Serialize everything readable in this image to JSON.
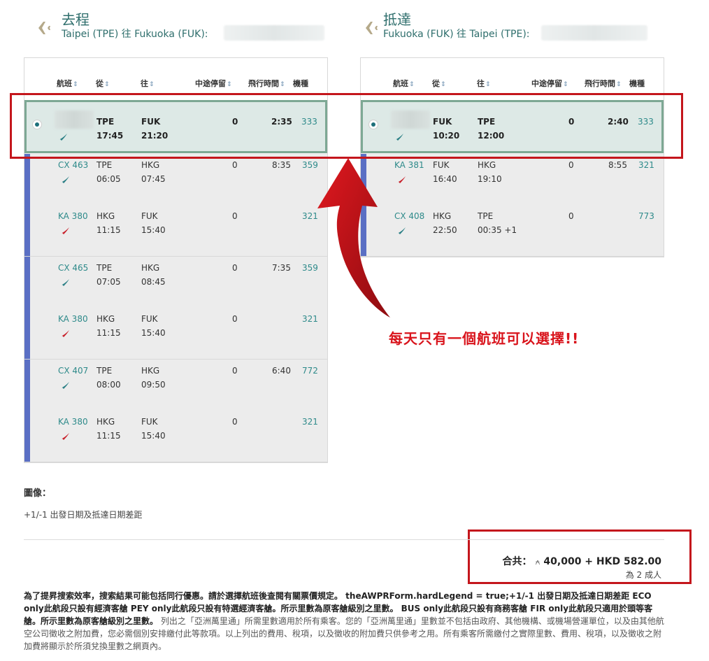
{
  "outbound": {
    "title": "去程",
    "route": "Taipei (TPE) 往 Fukuoka (FUK):"
  },
  "inbound": {
    "title": "抵達",
    "route": "Fukuoka (FUK) 往 Taipei (TPE):"
  },
  "columns": {
    "flight": "航班",
    "from": "從",
    "to": "往",
    "stops": "中途停留",
    "duration": "飛行時間",
    "aircraft": "機種",
    "sort_icon": "⇕"
  },
  "outbound_selected": {
    "from": "TPE",
    "dep": "17:45",
    "to": "FUK",
    "arr": "21:20",
    "stops": "0",
    "duration": "2:35",
    "aircraft": "333"
  },
  "outbound_options": [
    {
      "duration": "8:35",
      "legs": [
        {
          "flight": "CX 463",
          "from": "TPE",
          "dep": "06:05",
          "to": "HKG",
          "arr": "07:45",
          "stops": "0",
          "aircraft": "359",
          "airline": "cathay"
        },
        {
          "flight": "KA 380",
          "from": "HKG",
          "dep": "11:15",
          "to": "FUK",
          "arr": "15:40",
          "stops": "0",
          "aircraft": "321",
          "airline": "dragon"
        }
      ]
    },
    {
      "duration": "7:35",
      "legs": [
        {
          "flight": "CX 465",
          "from": "TPE",
          "dep": "07:05",
          "to": "HKG",
          "arr": "08:45",
          "stops": "0",
          "aircraft": "359",
          "airline": "cathay"
        },
        {
          "flight": "KA 380",
          "from": "HKG",
          "dep": "11:15",
          "to": "FUK",
          "arr": "15:40",
          "stops": "0",
          "aircraft": "321",
          "airline": "dragon"
        }
      ]
    },
    {
      "duration": "6:40",
      "legs": [
        {
          "flight": "CX 407",
          "from": "TPE",
          "dep": "08:00",
          "to": "HKG",
          "arr": "09:50",
          "stops": "0",
          "aircraft": "772",
          "airline": "cathay"
        },
        {
          "flight": "KA 380",
          "from": "HKG",
          "dep": "11:15",
          "to": "FUK",
          "arr": "15:40",
          "stops": "0",
          "aircraft": "321",
          "airline": "dragon"
        }
      ]
    }
  ],
  "inbound_selected": {
    "from": "FUK",
    "dep": "10:20",
    "to": "TPE",
    "arr": "12:00",
    "stops": "0",
    "duration": "2:40",
    "aircraft": "333"
  },
  "inbound_options": [
    {
      "duration": "8:55",
      "legs": [
        {
          "flight": "KA 381",
          "from": "FUK",
          "dep": "16:40",
          "to": "HKG",
          "arr": "19:10",
          "stops": "0",
          "aircraft": "321",
          "airline": "dragon"
        },
        {
          "flight": "CX 408",
          "from": "HKG",
          "dep": "22:50",
          "to": "TPE",
          "arr": "00:35 +1",
          "stops": "0",
          "aircraft": "773",
          "airline": "cathay"
        }
      ]
    }
  ],
  "callout": "每天只有一個航班可以選擇!!",
  "legend": {
    "title": "圖像：",
    "item": "+1/-1 出發日期及抵達日期差距"
  },
  "total": {
    "label": "合共：",
    "miles_symbol": "⍲",
    "amount": "40,000 + HKD 582.00",
    "per": "為 2 成人"
  },
  "notes": {
    "bold": "為了提昇搜索效率，搜索結果可能包括同行優惠。請於選擇航班後查閱有關票價規定。 theAWPRForm.hardLegend = true;+1/-1 出發日期及抵達日期差距 ECO only此航段只設有經濟客艙 PEY only此航段只設有特選經濟客艙。所示里數為原客艙級別之里數。 BUS only此航段只設有商務客艙 FIR only此航段只適用於頭等客艙。所示里數為原客艙級別之里數。",
    "normal": " 列出之「亞洲萬里通」所需里數適用於所有乘客。您的「亞洲萬里通」里數並不包括由政府、其他機構、或機場營運單位，以及由其他航空公司徵收之附加費，您必需個別安排繳付此等款項。以上列出的費用、稅項，以及徵收的附加費只供參考之用。所有乘客所需繳付之實際里數、費用、稅項，以及徵收之附加費將顯示於所須兌換里數之網頁內。"
  },
  "colors": {
    "teal": "#2e8a8a",
    "selected_bg": "#dde9e6",
    "option_bar": "#5a6fc4",
    "highlight_red": "#c4161c",
    "cathay_logo": "#2b7f85",
    "dragon_logo": "#c8202a"
  }
}
